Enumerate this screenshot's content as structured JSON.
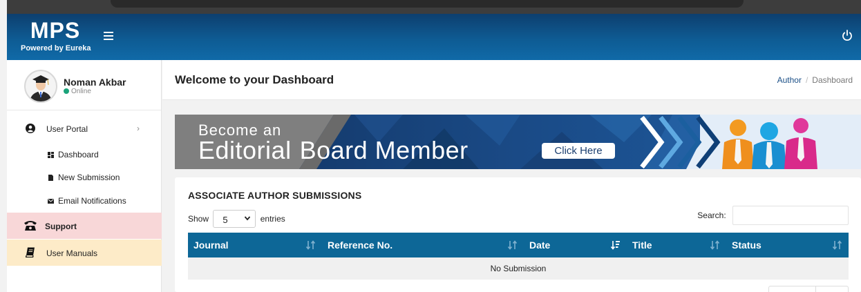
{
  "app": {
    "logo": "MPS",
    "tagline": "Powered by Eureka"
  },
  "user": {
    "name": "Noman Akbar",
    "status": "Online"
  },
  "sidebar": {
    "portal_label": "User Portal",
    "sub_items": [
      {
        "label": "Dashboard",
        "icon": "dashboard-icon"
      },
      {
        "label": "New Submission",
        "icon": "file-icon"
      },
      {
        "label": "Email Notifications",
        "icon": "envelope-icon"
      }
    ],
    "support_label": "Support",
    "manuals_label": "User Manuals"
  },
  "page": {
    "title": "Welcome to your Dashboard"
  },
  "breadcrumb": {
    "parent": "Author",
    "current": "Dashboard"
  },
  "banner": {
    "line1": "Become an",
    "line2a": "Editorial",
    "line2b": "Board Member",
    "button": "Click Here"
  },
  "table": {
    "title": "ASSOCIATE AUTHOR SUBMISSIONS",
    "show_label": "Show",
    "page_size": "5",
    "entries_label": "entries",
    "search_label": "Search:",
    "search_value": "",
    "columns": [
      "Journal",
      "Reference No.",
      "Date",
      "Title",
      "Status"
    ],
    "empty_text": "No Submission"
  },
  "colors": {
    "header": "#0e5b93",
    "table_header": "#0d6797",
    "support_bg": "#f8d7d8",
    "manuals_bg": "#fdebc8",
    "online": "#1aa37a"
  }
}
